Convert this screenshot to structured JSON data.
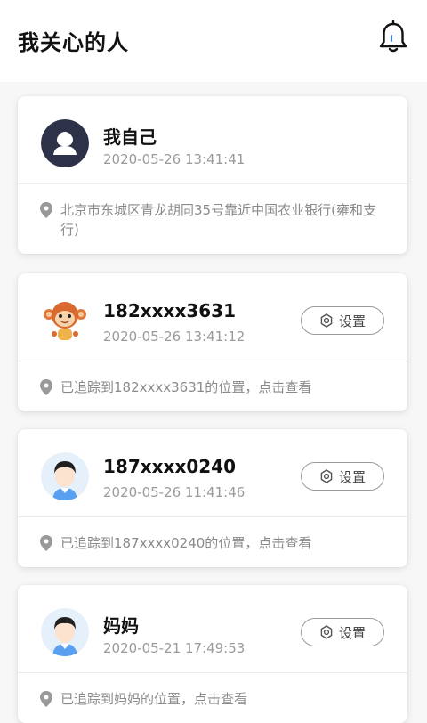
{
  "header": {
    "title": "我关心的人",
    "notification_icon": "bell-icon"
  },
  "people": [
    {
      "name": "我自己",
      "time": "2020-05-26 13:41:41",
      "location": "北京市东城区青龙胡同35号靠近中国农业银行(雍和支行)",
      "avatar": "dark-person-avatar"
    },
    {
      "name": "182xxxx3631",
      "time": "2020-05-26 13:41:12",
      "location": "已追踪到182xxxx3631的位置，点击查看",
      "settings_label": "设置",
      "avatar": "monkey-avatar"
    },
    {
      "name": "187xxxx0240",
      "time": "2020-05-26 11:41:46",
      "location": "已追踪到187xxxx0240的位置，点击查看",
      "settings_label": "设置",
      "avatar": "boy-avatar"
    },
    {
      "name": "妈妈",
      "time": "2020-05-21 17:49:53",
      "location": "已追踪到妈妈的位置，点击查看",
      "settings_label": "设置",
      "avatar": "boy-avatar"
    }
  ],
  "colors": {
    "background": "#f7f7f7",
    "card": "#ffffff",
    "muted_text": "#9a9a9a",
    "avatar_dark": "#2d3248",
    "avatar_light_bg": "#e6f0fb",
    "shirt_blue": "#5aa0f0"
  }
}
